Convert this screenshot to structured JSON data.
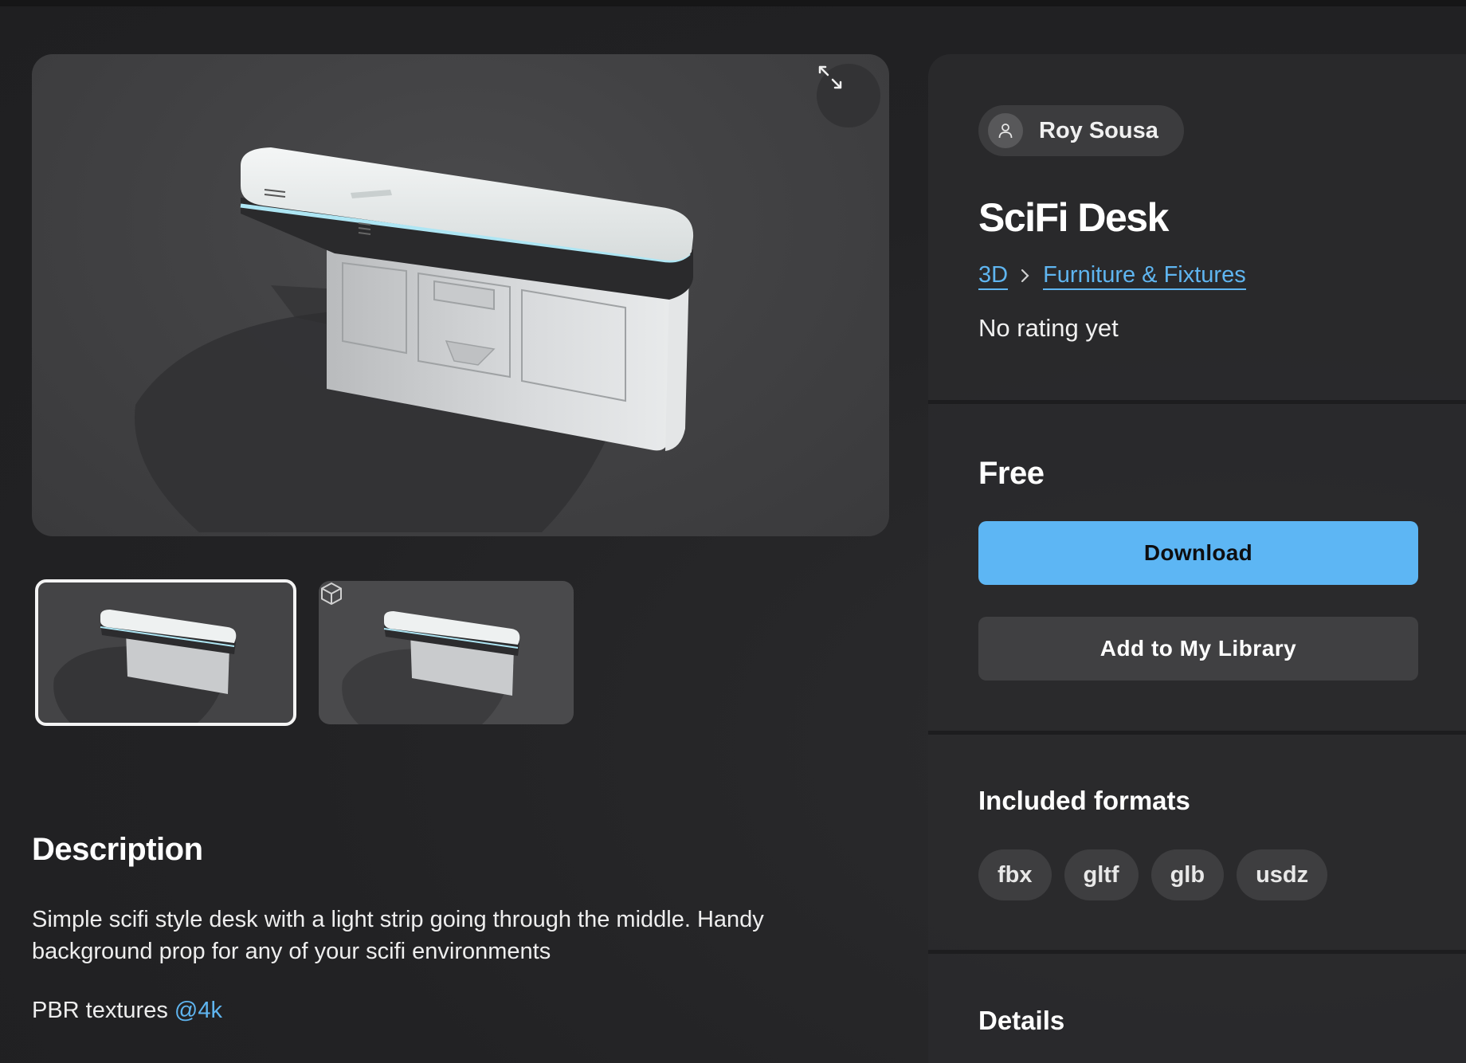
{
  "viewer": {
    "expand_icon": "expand-arrows-icon",
    "thumbnails": [
      {
        "kind": "image",
        "selected": true
      },
      {
        "kind": "3d-model",
        "icon": "cube-icon",
        "selected": false
      }
    ]
  },
  "description": {
    "heading": "Description",
    "body": "Simple scifi style desk with a light strip going through the middle. Handy background prop for any of your scifi environments",
    "pbr_prefix": "PBR textures ",
    "pbr_mention": "@4k"
  },
  "asset": {
    "author": "Roy Sousa",
    "author_icon": "user-icon",
    "title": "SciFi Desk",
    "breadcrumb": [
      "3D",
      "Furniture & Fixtures"
    ],
    "rating": "No rating yet",
    "price": "Free",
    "download_label": "Download",
    "library_label": "Add to My Library",
    "formats_heading": "Included formats",
    "formats": [
      "fbx",
      "gltf",
      "glb",
      "usdz"
    ],
    "details_heading": "Details"
  },
  "colors": {
    "accent": "#5db6f4",
    "link": "#5fb5f0",
    "background": "#232325"
  }
}
